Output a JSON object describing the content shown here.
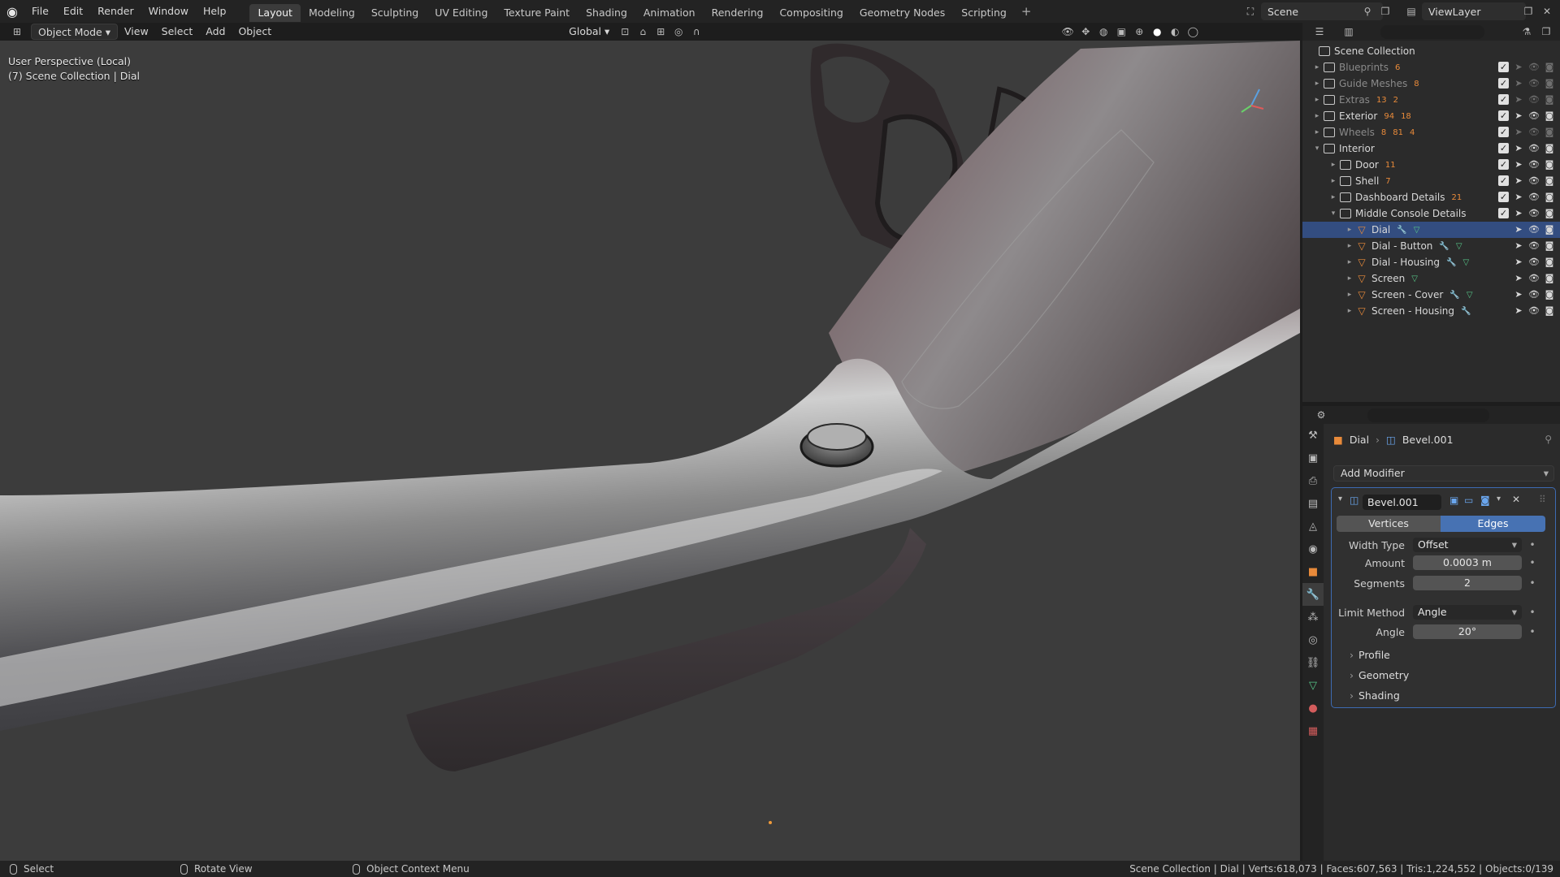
{
  "menu": [
    "File",
    "Edit",
    "Render",
    "Window",
    "Help"
  ],
  "workspaces": [
    "Layout",
    "Modeling",
    "Sculpting",
    "UV Editing",
    "Texture Paint",
    "Shading",
    "Animation",
    "Rendering",
    "Compositing",
    "Geometry Nodes",
    "Scripting"
  ],
  "active_workspace": "Layout",
  "add_workspace": "+",
  "scene": "Scene",
  "view_layer": "ViewLayer",
  "viewport_header": {
    "mode": "Object Mode",
    "menus": [
      "View",
      "Select",
      "Add",
      "Object"
    ],
    "transform_orientation": "Global"
  },
  "viewport": {
    "info_line1": "User Perspective (Local)",
    "info_line2": "(7) Scene Collection | Dial"
  },
  "outliner": {
    "root": "Scene Collection",
    "rows": [
      {
        "label": "Blueprints",
        "badges": [
          "6"
        ],
        "dim": true
      },
      {
        "label": "Guide Meshes",
        "badges": [
          "8"
        ],
        "dim": true
      },
      {
        "label": "Extras",
        "badges": [
          "13",
          "2"
        ],
        "dim": true
      },
      {
        "label": "Exterior",
        "badges": [
          "94",
          "18"
        ],
        "dim": false
      },
      {
        "label": "Wheels",
        "badges": [
          "8",
          "81",
          "4"
        ],
        "dim": true
      },
      {
        "label": "Interior",
        "badges": [],
        "dim": false
      },
      {
        "label": "Door",
        "badges": [
          "11"
        ],
        "dim": false
      },
      {
        "label": "Shell",
        "badges": [
          "7"
        ],
        "dim": false
      },
      {
        "label": "Dashboard Details",
        "badges": [
          "21"
        ],
        "dim": false
      },
      {
        "label": "Middle Console Details",
        "badges": [],
        "dim": false
      },
      {
        "label": "Dial",
        "badges": [],
        "dim": false
      },
      {
        "label": "Dial - Button",
        "badges": [],
        "dim": false
      },
      {
        "label": "Dial - Housing",
        "badges": [],
        "dim": false
      },
      {
        "label": "Screen",
        "badges": [],
        "dim": false
      },
      {
        "label": "Screen - Cover",
        "badges": [],
        "dim": false
      },
      {
        "label": "Screen - Housing",
        "badges": [],
        "dim": false
      }
    ]
  },
  "properties": {
    "breadcrumb_object": "Dial",
    "breadcrumb_modifier": "Bevel.001",
    "add_modifier": "Add Modifier",
    "modifier": {
      "name": "Bevel.001",
      "affect_vertices": "Vertices",
      "affect_edges": "Edges",
      "width_type_label": "Width Type",
      "width_type": "Offset",
      "amount_label": "Amount",
      "amount": "0.0003 m",
      "segments_label": "Segments",
      "segments": "2",
      "limit_method_label": "Limit Method",
      "limit_method": "Angle",
      "angle_label": "Angle",
      "angle": "20°",
      "subpanels": [
        "Profile",
        "Geometry",
        "Shading"
      ]
    }
  },
  "statusbar": {
    "select": "Select",
    "rotate": "Rotate View",
    "context": "Object Context Menu",
    "stats": "Scene Collection | Dial | Verts:618,073 | Faces:607,563 | Tris:1,224,552 | Objects:0/139"
  },
  "colors": {
    "accent": "#4772b3",
    "selection": "#334d80",
    "mesh_orange": "#e88a3a",
    "viewport_bg": "#3c3c3c"
  }
}
